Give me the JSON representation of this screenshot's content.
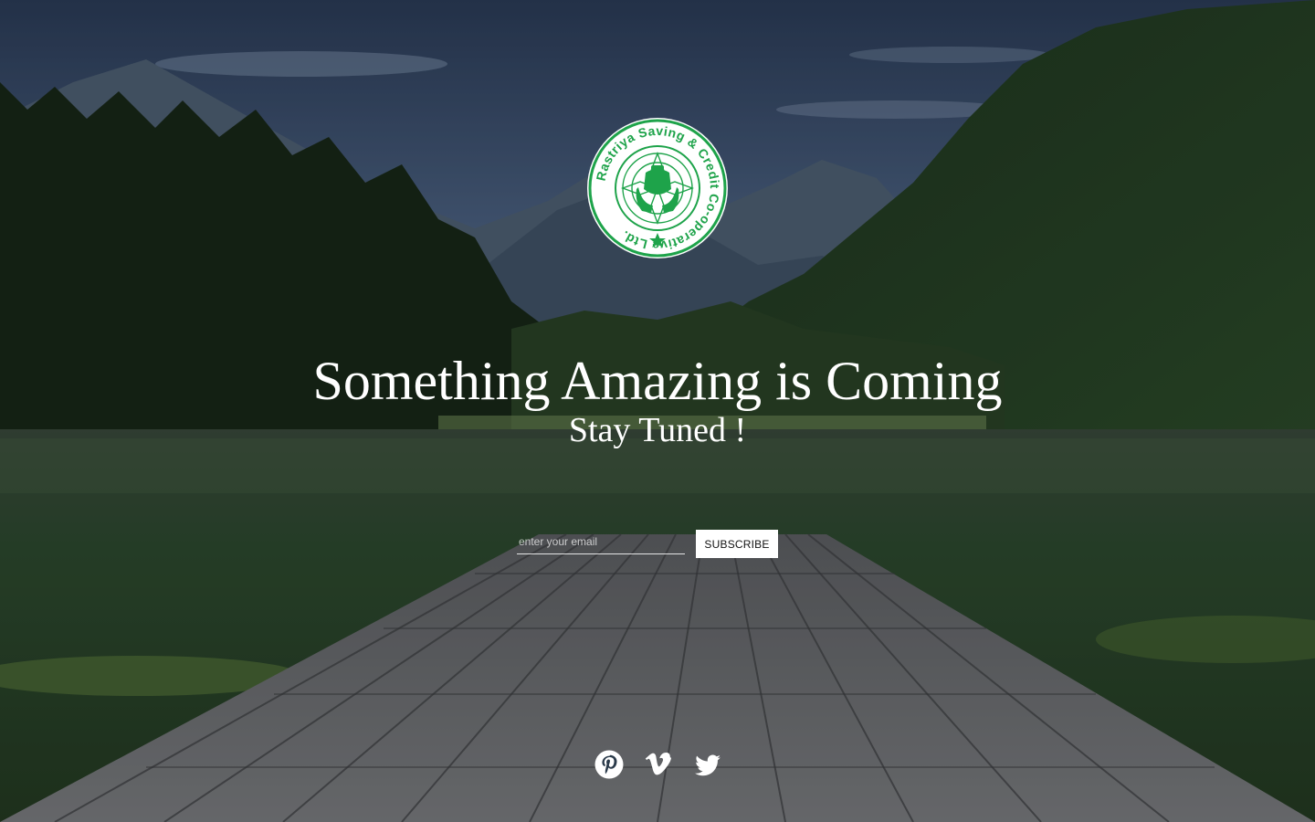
{
  "logo": {
    "text": "Rastriya Saving & Credit Co-operative Ltd.",
    "color": "#1ea34a"
  },
  "hero": {
    "headline": "Something Amazing is Coming",
    "subheadline": "Stay Tuned !"
  },
  "subscribe": {
    "email_placeholder": "enter your email",
    "email_value": "",
    "button_label": "SUBSCRIBE"
  },
  "social": [
    {
      "name": "Pinterest",
      "icon": "pinterest-icon"
    },
    {
      "name": "Vimeo",
      "icon": "vimeo-icon"
    },
    {
      "name": "Twitter",
      "icon": "twitter-icon"
    }
  ],
  "colors": {
    "text": "#ffffff",
    "accent": "#1ea34a",
    "button_bg": "#ffffff",
    "button_text": "#111111"
  }
}
